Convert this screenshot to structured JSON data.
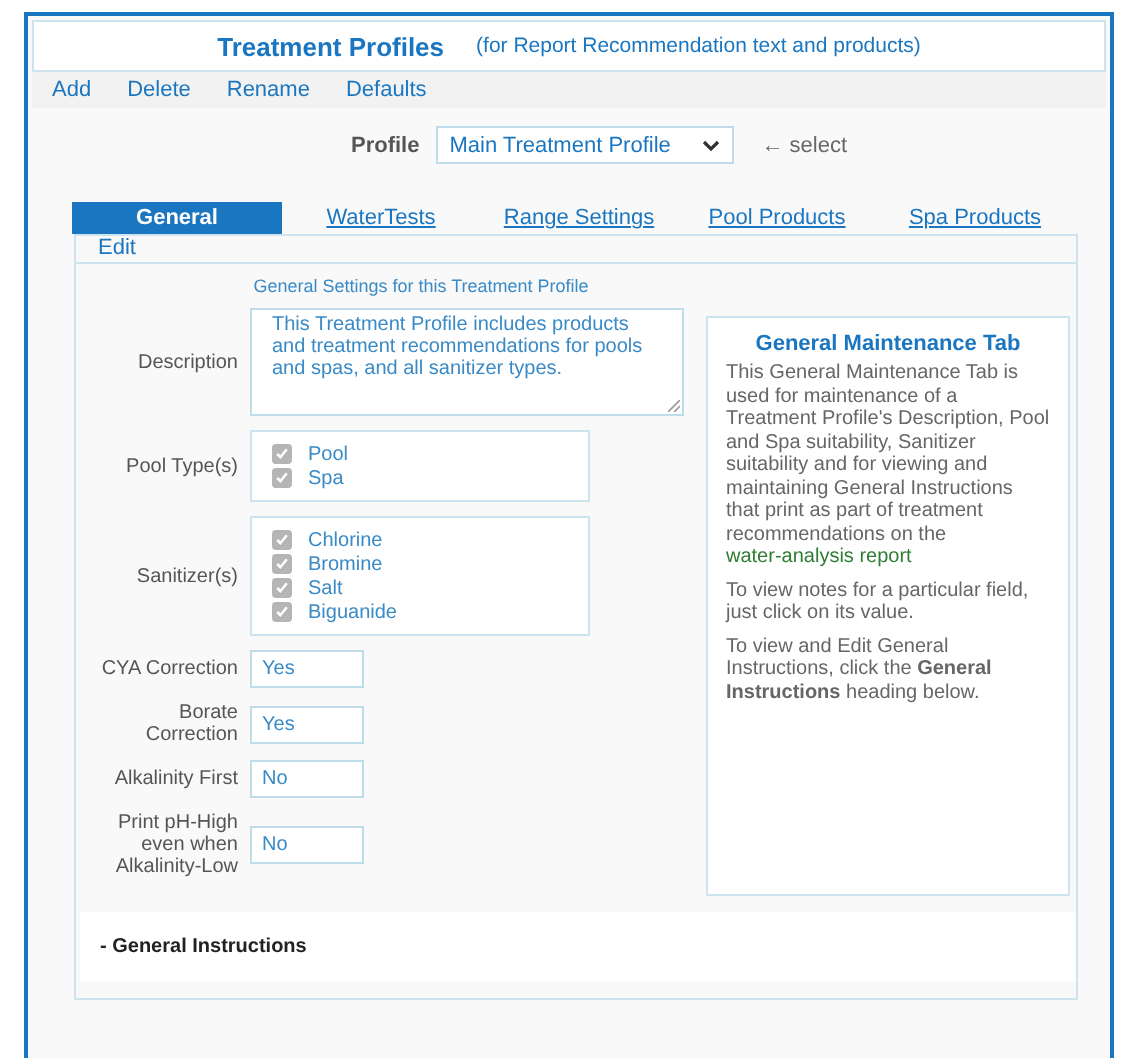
{
  "window": {
    "title": "Treatment Profiles",
    "subtitle": "(for Report Recommendation text and products)"
  },
  "menu": [
    "Add",
    "Delete",
    "Rename",
    "Defaults"
  ],
  "profile": {
    "label": "Profile",
    "value": "Main Treatment Profile",
    "hint": "← select"
  },
  "tabs": [
    {
      "label": "General",
      "selected": true
    },
    {
      "label": "WaterTests",
      "selected": false
    },
    {
      "label": "Range Settings",
      "selected": false
    },
    {
      "label": "Pool Products",
      "selected": false
    },
    {
      "label": "Spa Products",
      "selected": false
    }
  ],
  "edit_link": "Edit",
  "section_title": "General Settings for this Treatment Profile",
  "fields": [
    {
      "kind": "textarea",
      "label": "Description",
      "value": "This Treatment Profile includes products and treatment recommendations for pools and spas, and all sanitizer types."
    },
    {
      "kind": "checklist",
      "label": "Pool Type(s)",
      "options": [
        {
          "label": "Pool",
          "checked": true
        },
        {
          "label": "Spa",
          "checked": true
        }
      ]
    },
    {
      "kind": "checklist",
      "label": "Sanitizer(s)",
      "options": [
        {
          "label": "Chlorine",
          "checked": true
        },
        {
          "label": "Bromine",
          "checked": true
        },
        {
          "label": "Salt",
          "checked": true
        },
        {
          "label": "Biguanide",
          "checked": true
        }
      ]
    },
    {
      "kind": "text",
      "label": "CYA Correction",
      "value": "Yes"
    },
    {
      "kind": "text",
      "label": "Borate Correction",
      "value": "Yes"
    },
    {
      "kind": "text",
      "label": "Alkalinity First",
      "value": "No"
    },
    {
      "kind": "text",
      "label": "Print pH-High even when Alkalinity-Low",
      "value": "No"
    }
  ],
  "help": {
    "title": "General Maintenance Tab",
    "intro": "This General Maintenance Tab is used for maintenance of a Treatment Profile's Description, Pool and Spa suitability, Sanitizer suitability and for viewing and maintaining General Instructions that print as part of treatment recommendations on the",
    "link": "water-analysis report",
    "paragraphs": [
      "To view notes for a particular field, just click on its value.",
      "To view and Edit General Instructions, click the **General Instructions** heading below."
    ]
  },
  "instructions_heading": "- General Instructions"
}
